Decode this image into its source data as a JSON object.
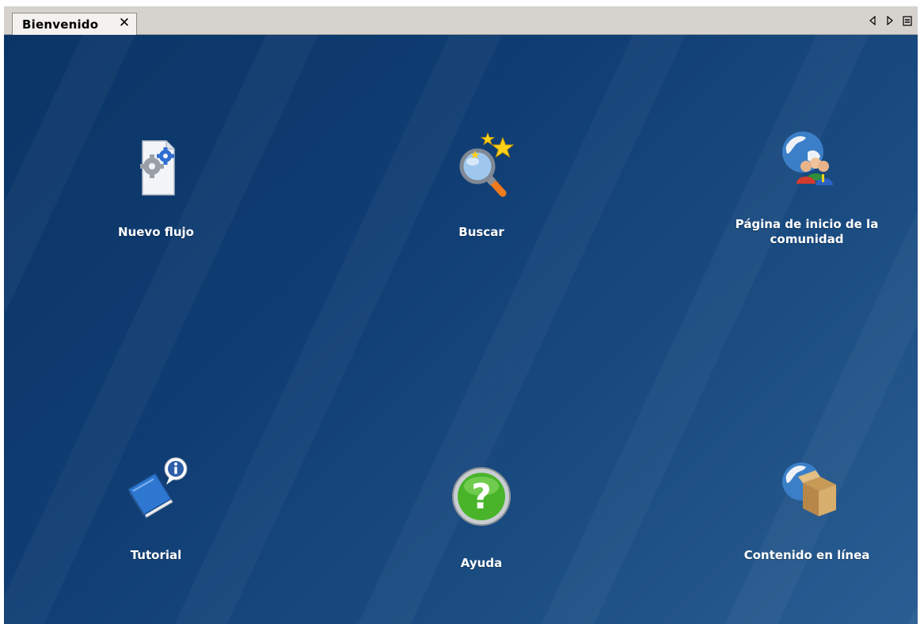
{
  "tab": {
    "label": "Bienvenido",
    "close_icon": "close-icon"
  },
  "tab_controls": [
    "scroll-left-icon",
    "scroll-right-icon",
    "tab-list-icon"
  ],
  "tiles": [
    {
      "label": "Nuevo flujo",
      "icon": "new-flow-icon"
    },
    {
      "label": "Buscar",
      "icon": "search-icon"
    },
    {
      "label": "Página de inicio de la comunidad",
      "icon": "community-home-icon"
    },
    {
      "label": "Tutorial",
      "icon": "tutorial-icon"
    },
    {
      "label": "Ayuda",
      "icon": "help-icon"
    },
    {
      "label": "Contenido en línea",
      "icon": "online-content-icon"
    }
  ],
  "colors": {
    "background": "#0f3c72",
    "tab_bar": "#d6d3ce",
    "label_text": "#ffffff"
  }
}
